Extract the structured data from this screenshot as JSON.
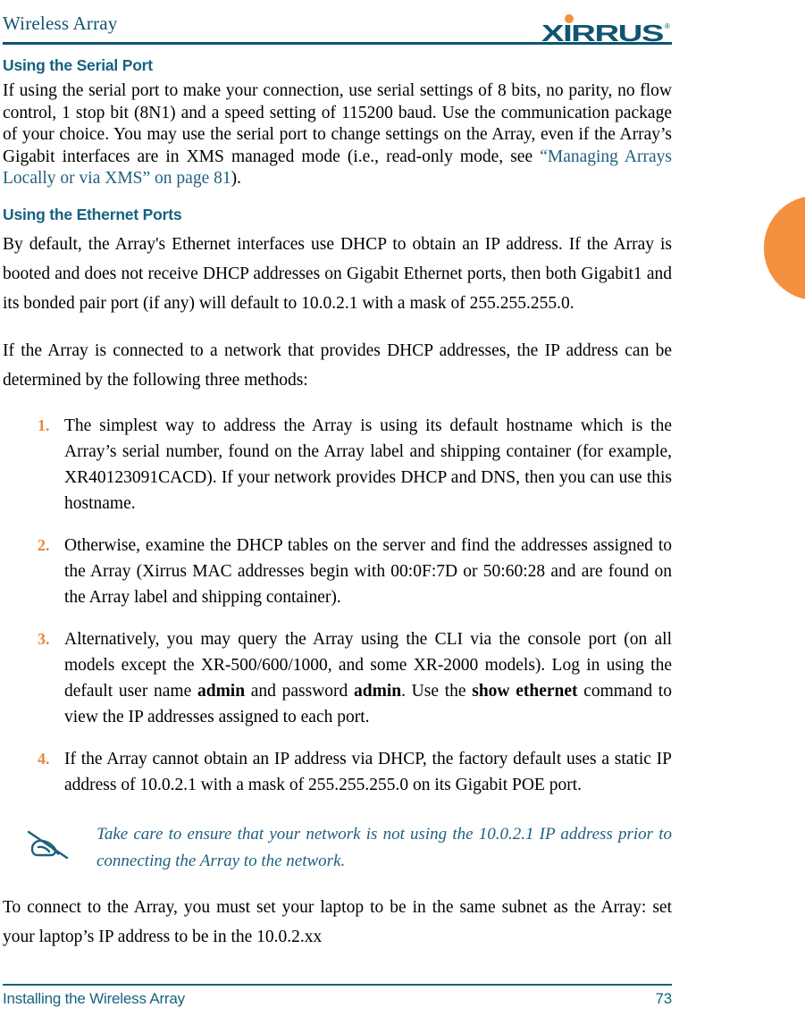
{
  "document": {
    "header": {
      "title": "Wireless Array",
      "logo_text": "XIRRUS",
      "logo_trademark": "®",
      "logo_icon_name": "xirrus-logo"
    },
    "footer": {
      "left_text": "Installing the Wireless Array",
      "page_number": "73"
    },
    "colors": {
      "heading_teal": "#15627F",
      "header_title_teal": "#0F5570",
      "link_teal": "#1F6080",
      "accent_orange": "#E8883A",
      "tab_orange": "#F4913E",
      "body_black": "#000000"
    },
    "margin_tab": {
      "name": "chapter-thumb-tab",
      "color": "#F4913E"
    },
    "sections": [
      {
        "heading": "Using the Serial Port",
        "paragraphs": [
          {
            "parts": [
              {
                "type": "text",
                "text": "If using the serial port to make your connection, use serial settings of 8 bits, no parity, no flow control, 1 stop bit (8N1) and a speed setting of 115200 baud. Use the communication package of your choice. You may use the serial port to change settings on the Array, even if the Array’s Gigabit interfaces are in XMS managed mode (i.e., read-only mode, see "
              },
              {
                "type": "link",
                "text": "“Managing Arrays Locally or via XMS” on page 81"
              },
              {
                "type": "text",
                "text": ")."
              }
            ]
          }
        ]
      },
      {
        "heading": "Using the Ethernet Ports",
        "paragraphs": [
          {
            "parts": [
              {
                "type": "text",
                "text": "By default, the Array's Ethernet interfaces use DHCP to obtain an IP address. If the Array is booted and does not receive DHCP addresses on Gigabit Ethernet ports, then both Gigabit1 and its bonded pair port (if any) will default to 10.0.2.1 with a mask of 255.255.255.0."
              }
            ]
          },
          {
            "parts": [
              {
                "type": "text",
                "text": "If the Array is connected to a network that provides DHCP addresses, the IP address can be determined by the following three methods:"
              }
            ]
          }
        ]
      }
    ],
    "steps": [
      {
        "number": "1.",
        "parts": [
          {
            "type": "text",
            "text": "The simplest way to address the Array is using its default hostname which is the Array’s serial number, found on the Array label and shipping container (for example, XR40123091CACD). If your network provides DHCP and DNS, then you can use this hostname."
          }
        ]
      },
      {
        "number": "2.",
        "parts": [
          {
            "type": "text",
            "text": "Otherwise, examine the DHCP tables on the server and find the addresses assigned to the Array (Xirrus MAC addresses begin with 00:0F:7D or 50:60:28 and are found on the Array label and shipping container)."
          }
        ]
      },
      {
        "number": "3.",
        "parts": [
          {
            "type": "text",
            "text": "Alternatively, you may query the Array using the CLI via the console port (on all models except the XR-500/600/1000, and some XR-2000 models). Log in using the default user name "
          },
          {
            "type": "bold",
            "text": "admin"
          },
          {
            "type": "text",
            "text": " and password "
          },
          {
            "type": "bold",
            "text": "admin"
          },
          {
            "type": "text",
            "text": ". Use the "
          },
          {
            "type": "bold",
            "text": "show ethernet"
          },
          {
            "type": "text",
            "text": " command to view the IP addresses assigned to each port."
          }
        ]
      },
      {
        "number": "4.",
        "parts": [
          {
            "type": "text",
            "text": "If the Array cannot obtain an IP address via DHCP, the factory default uses a static IP address of 10.0.2.1 with a mask of 255.255.255.0 on its Gigabit POE port."
          }
        ]
      }
    ],
    "note": {
      "icon_name": "note-pencil-icon",
      "text": "Take care to ensure that your network is not using the 10.0.2.1 IP address prior to connecting the Array to the network."
    },
    "closing_paragraph": {
      "parts": [
        {
          "type": "text",
          "text": "To connect to the Array, you must set your laptop to be in the same subnet as the Array: set your laptop’s IP address to be in the 10.0.2.xx"
        }
      ]
    }
  }
}
